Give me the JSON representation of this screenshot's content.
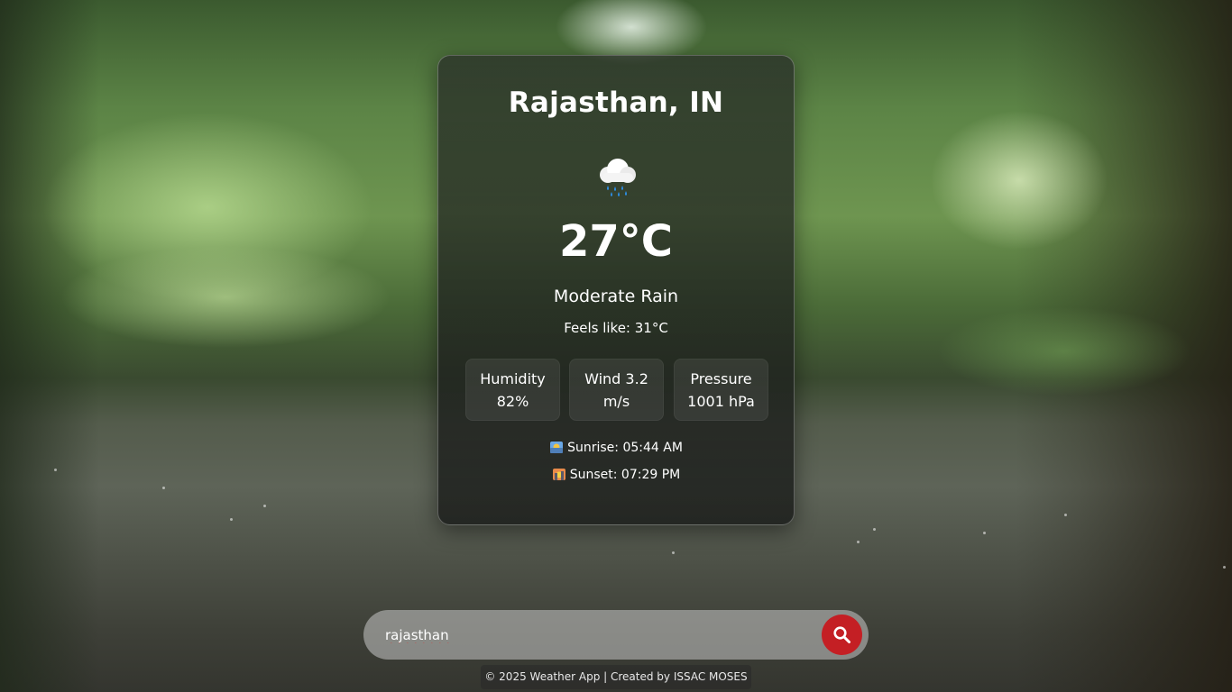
{
  "weather": {
    "city": "Rajasthan, IN",
    "icon": "rain-cloud-icon",
    "temperature": "27°C",
    "description": "Moderate Rain",
    "feels_like": "Feels like: 31°C",
    "stats": [
      {
        "line1": "Humidity",
        "line2": "82%"
      },
      {
        "line1": "Wind 3.2",
        "line2": "m/s"
      },
      {
        "line1": "Pressure",
        "line2": "1001 hPa"
      }
    ],
    "sunrise": "Sunrise: 05:44 AM",
    "sunset": "Sunset: 07:29 PM",
    "sunrise_icon": "sunrise-icon",
    "sunset_icon": "sunset-icon"
  },
  "search": {
    "value": "rajasthan",
    "button_icon": "search-icon"
  },
  "footer": {
    "text": "© 2025 Weather App | Created by ISSAC MOSES"
  },
  "colors": {
    "search_button": "#c41f24",
    "card_background": "rgba(30,32,30,0.78)",
    "text": "#ffffff"
  }
}
